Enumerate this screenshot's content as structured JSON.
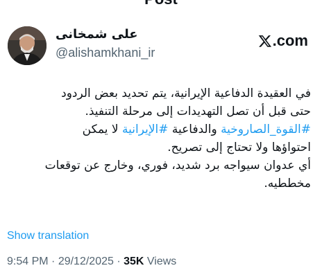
{
  "header": {
    "title": "Post"
  },
  "profile": {
    "name": "علی شمخانی",
    "handle": "@alishamkhani_ir",
    "avatar_icon": "profile-photo"
  },
  "watermark": {
    "text": ".com",
    "icon": "x-logo-icon"
  },
  "tweet": {
    "line1": "في العقيدة الدفاعية الإيرانية، يتم تحديد بعض الردود",
    "line2": "حتى قبل أن تصل التهديدات إلى مرحلة التنفيذ.",
    "line3_hashtag1": "#القوة_الصاروخية",
    "line3_mid": " والدفاعية ",
    "line3_hashtag2": "#الإيرانية",
    "line3_end": " لا يمكن",
    "line4": "احتواؤها ولا تحتاج إلى تصريح.",
    "line5": "أي عدوان سيواجه برد شديد، فوري، وخارج عن توقعات",
    "line6": "مخططيه."
  },
  "actions": {
    "show_translation": "Show translation"
  },
  "meta": {
    "time": "9:54 PM",
    "separator1": " · ",
    "date": "29/12/2025",
    "separator2": " · ",
    "views_count": "35K",
    "views_label": " Views"
  },
  "colors": {
    "link": "#1d9bf0",
    "secondary_text": "#536471",
    "primary_text": "#0f1419"
  }
}
